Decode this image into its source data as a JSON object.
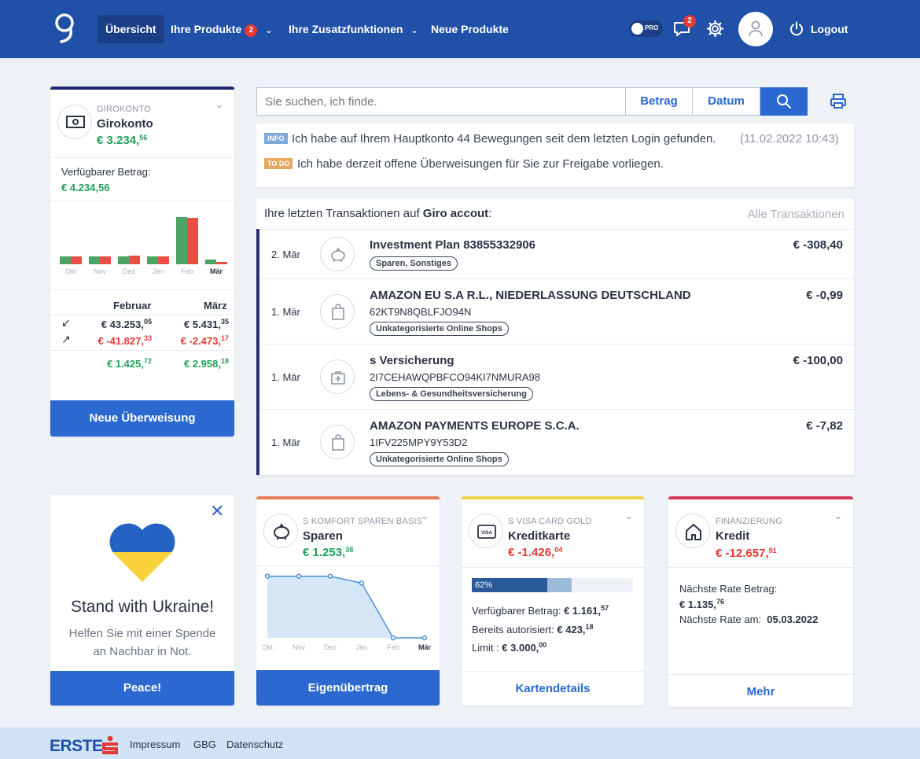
{
  "nav": {
    "items": [
      "Übersicht",
      "Ihre Produkte",
      "Ihre Zusatzfunktionen",
      "Neue Produkte"
    ],
    "products_badge": "2",
    "pro_label": "PRO",
    "messages_badge": "2",
    "logout": "Logout"
  },
  "giro": {
    "caption": "GIROKONTO",
    "name": "Girokonto",
    "balance": "€ 3.234,",
    "balance_cents": "56",
    "available_label": "Verfügbarer Betrag:",
    "available": "€ 4.234,56",
    "chart_months": [
      "Okt",
      "Nov",
      "Dez",
      "Jän",
      "Feb",
      "Mär"
    ],
    "chart_in": [
      0.17,
      0.17,
      0.16,
      0.16,
      1.0,
      0.1
    ],
    "chart_out": [
      0.17,
      0.17,
      0.18,
      0.16,
      0.98,
      0.05
    ],
    "col_feb": "Februar",
    "col_mar": "März",
    "in_feb": "€ 43.253,",
    "in_feb_c": "05",
    "in_mar": "€ 5.431,",
    "in_mar_c": "35",
    "out_feb": "€ -41.827,",
    "out_feb_c": "33",
    "out_mar": "€ -2.473,",
    "out_mar_c": "17",
    "sum_feb": "€ 1.425,",
    "sum_feb_c": "72",
    "sum_mar": "€ 2.958,",
    "sum_mar_c": "18",
    "button": "Neue Überweisung"
  },
  "search": {
    "placeholder": "Sie suchen, ich finde.",
    "betrag": "Betrag",
    "datum": "Datum"
  },
  "info": {
    "info_tag": "INFO",
    "info_text": "Ich habe auf Ihrem Hauptkonto 44 Bewegungen seit dem letzten Login gefunden.",
    "info_time": "(11.02.2022 10:43)",
    "todo_tag": "TO DO",
    "todo_text": "Ich habe derzeit offene Überweisungen für Sie zur Freigabe vorliegen."
  },
  "tx": {
    "header_prefix": "Ihre letzten Transaktionen auf ",
    "header_account": "Giro accout",
    "header_suffix": ":",
    "all_link": "Alle Transaktionen",
    "rows": [
      {
        "date": "2. Mär",
        "title": "Investment Plan 83855332906",
        "ref": "",
        "tag": "Sparen, Sonstiges",
        "amount": "€ -308,40"
      },
      {
        "date": "1. Mär",
        "title": "AMAZON EU S.A R.L., NIEDERLASSUNG DEUTSCHLAND",
        "ref": "62KT9N8QBLFJO94N",
        "tag": "Unkategorisierte Online Shops",
        "amount": "€ -0,99"
      },
      {
        "date": "1. Mär",
        "title": "s Versicherung",
        "ref": "2I7CEHAWQPBFCO94KI7NMURA98",
        "tag": "Lebens- & Gesundheitsversicherung",
        "amount": "€ -100,00"
      },
      {
        "date": "1. Mär",
        "title": "AMAZON PAYMENTS EUROPE S.C.A.",
        "ref": "1IFV225MPY9Y53D2",
        "tag": "Unkategorisierte Online Shops",
        "amount": "€ -7,82"
      }
    ]
  },
  "ukraine": {
    "title": "Stand with Ukraine!",
    "text1": "Helfen Sie mit einer Spende",
    "text2": "an Nachbar in Not.",
    "button": "Peace!"
  },
  "sparen": {
    "caption": "S KOMFORT SPAREN BASIS",
    "name": "Sparen",
    "balance": "€ 1.253,",
    "balance_cents": "38",
    "months": [
      "Okt",
      "Nov",
      "Dez",
      "Jän",
      "Feb",
      "Mär"
    ],
    "levels": [
      0.98,
      0.98,
      0.98,
      0.87,
      0.0,
      0.0
    ],
    "button": "Eigenübertrag"
  },
  "kredit_card": {
    "caption": "S VISA CARD GOLD",
    "name": "Kreditkarte",
    "balance": "€ -1.426,",
    "balance_cents": "04",
    "percent_label": "62%",
    "used_fraction": 0.47,
    "authorized_fraction": 0.15,
    "available_label": "Verfügbarer Betrag:",
    "available": "€ 1.161,",
    "available_c": "57",
    "authorized_label": "Bereits autorisiert:",
    "authorized": "€ 423,",
    "authorized_c": "18",
    "limit_label": "Limit :",
    "limit": "€ 3.000,",
    "limit_c": "00",
    "link": "Kartendetails"
  },
  "loan": {
    "caption": "FINANZIERUNG",
    "name": "Kredit",
    "balance": "€ -12.657,",
    "balance_cents": "91",
    "rate_label": "Nächste Rate Betrag:",
    "rate": "€ 1.135,",
    "rate_c": "76",
    "date_label": "Nächste Rate am:",
    "date": "05.03.2022",
    "link": "Mehr"
  },
  "footer": {
    "brand": "ERSTE",
    "links": [
      "Impressum",
      "GBG",
      "Datenschutz"
    ]
  },
  "colors": {
    "brand": "#2150a8",
    "accent": "#2b68d0",
    "green": "#1ea05a",
    "red": "#e53935"
  }
}
